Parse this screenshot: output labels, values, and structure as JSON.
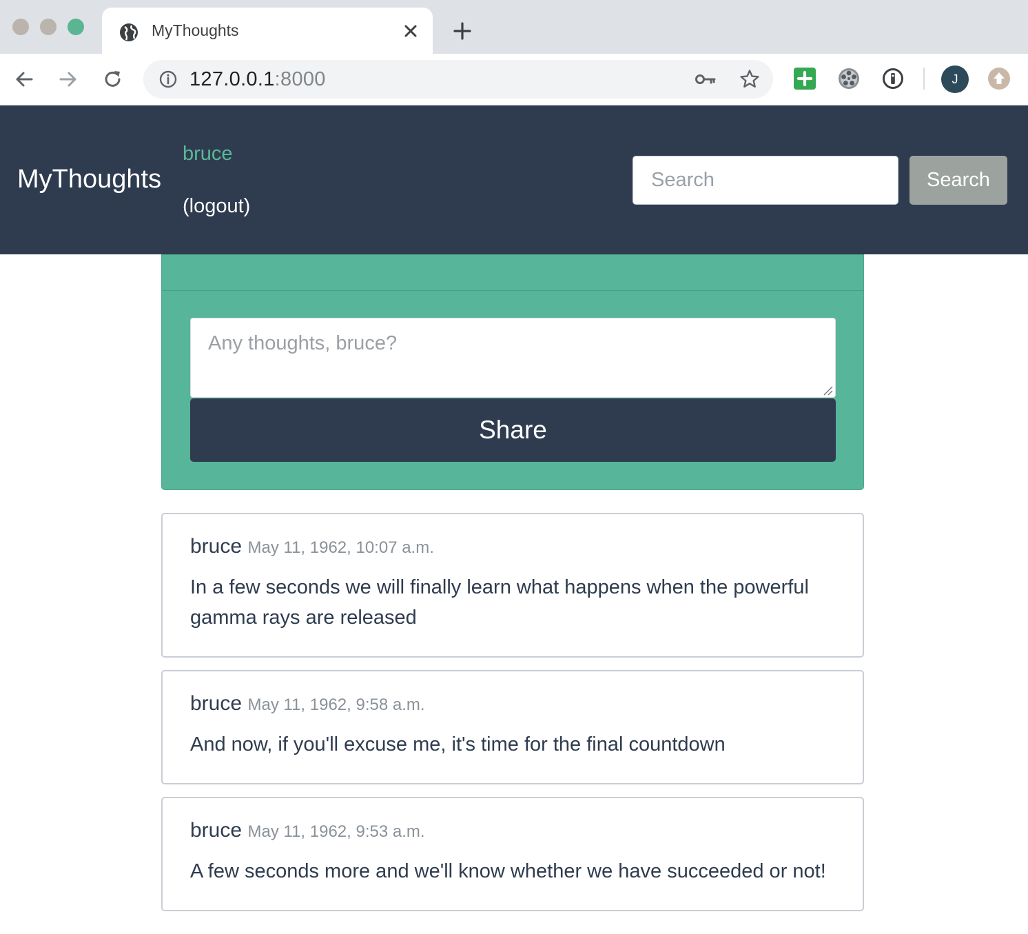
{
  "browser": {
    "tab_title": "MyThoughts",
    "url_host": "127.0.0.1",
    "url_port": ":8000",
    "profile_initial": "J"
  },
  "nav": {
    "brand": "MyThoughts",
    "username": "bruce",
    "logout": "(logout)",
    "search_placeholder": "Search",
    "search_button": "Search"
  },
  "compose": {
    "placeholder": "Any thoughts, bruce?",
    "share_button": "Share"
  },
  "posts": [
    {
      "author": "bruce",
      "date": "May 11, 1962, 10:07 a.m.",
      "text": "In a few seconds we will finally learn what happens when the powerful gamma rays are released"
    },
    {
      "author": "bruce",
      "date": "May 11, 1962, 9:58 a.m.",
      "text": "And now, if you'll excuse me, it's time for the final countdown"
    },
    {
      "author": "bruce",
      "date": "May 11, 1962, 9:53 a.m.",
      "text": "A few seconds more and we'll know whether we have succeeded or not!"
    }
  ],
  "colors": {
    "navbar": "#2f3c4f",
    "accent_green": "#57b599",
    "search_button": "#9ca39e"
  },
  "icons": {
    "tab": "globe-icon",
    "back": "arrow-left-icon",
    "forward": "arrow-right-icon",
    "reload": "reload-icon",
    "site_info": "info-icon",
    "password": "key-icon",
    "bookmark": "star-icon"
  }
}
